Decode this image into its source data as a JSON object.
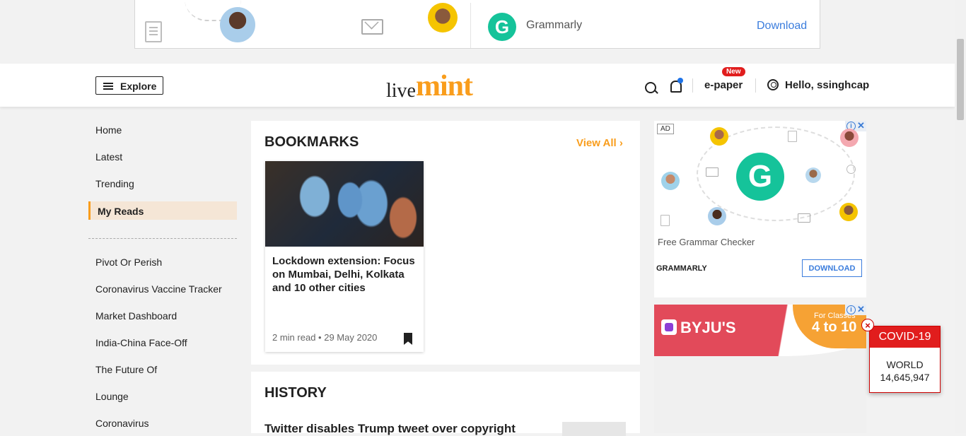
{
  "top_ad": {
    "brand": "Grammarly",
    "cta": "Download"
  },
  "header": {
    "explore": "Explore",
    "logo_live": "live",
    "logo_mint": "mint",
    "epaper": "e-paper",
    "new_badge": "New",
    "greeting": "Hello, ssinghcap"
  },
  "nav": {
    "primary": [
      "Home",
      "Latest",
      "Trending"
    ],
    "active": "My Reads",
    "secondary": [
      "Pivot Or Perish",
      "Coronavirus Vaccine Tracker",
      "Market Dashboard",
      "India-China Face-Off",
      "The Future Of",
      "Lounge",
      "Coronavirus"
    ]
  },
  "bookmarks": {
    "title": "BOOKMARKS",
    "view_all": "View All",
    "card": {
      "title": "Lockdown extension: Focus on Mumbai, Delhi, Kolkata and 10 other cities",
      "read_time": "2 min read",
      "dot": "•",
      "date": "29 May 2020"
    }
  },
  "history": {
    "title": "HISTORY",
    "first_item": "Twitter disables Trump tweet over copyright"
  },
  "right_ad1": {
    "label": "AD",
    "text": "Free Grammar Checker",
    "brand": "GRAMMARLY",
    "cta": "DOWNLOAD"
  },
  "right_ad2": {
    "brand": "BYJU'S",
    "tagline": "For Classes",
    "range": "4 to 10"
  },
  "covid": {
    "title": "COVID-19",
    "region": "WORLD",
    "count": "14,645,947"
  },
  "colors": {
    "accent": "#f99d1c",
    "grammarly_green": "#15c39a",
    "covid_red": "#e11d1d",
    "link_blue": "#3b7ddd"
  }
}
